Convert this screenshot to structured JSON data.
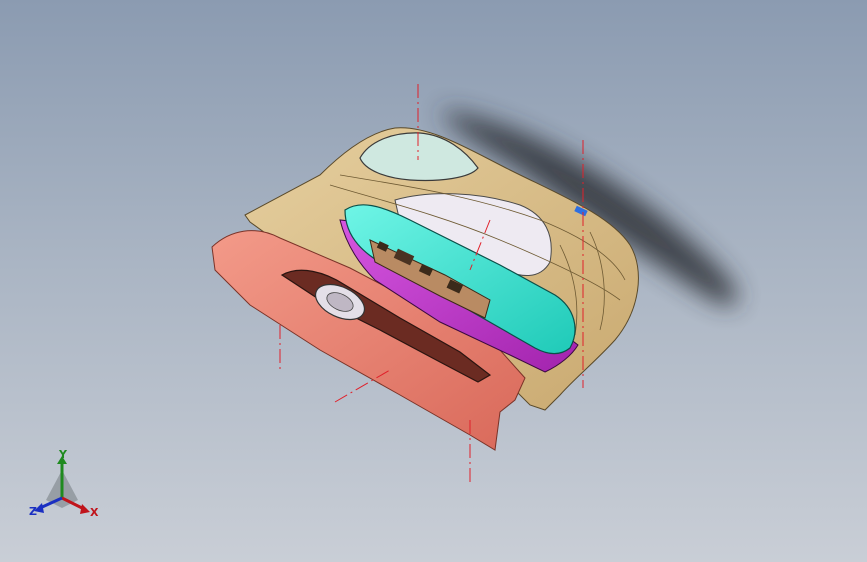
{
  "viewport": {
    "background_top": "#8b9bb1",
    "background_bottom": "#c9ced6"
  },
  "model": {
    "description_icon": "car-door-armrest-panel",
    "colors": {
      "panel_tan": "#d8bf8e",
      "trim_salmon": "#ec8576",
      "armrest_cyan": "#3fe8d6",
      "armrest_magenta": "#c83ad4",
      "shadow": "#3b3f46",
      "centerline": "#e0202a"
    }
  },
  "triad": {
    "y_label": "Y",
    "x_label": "X",
    "z_label": "Z"
  }
}
